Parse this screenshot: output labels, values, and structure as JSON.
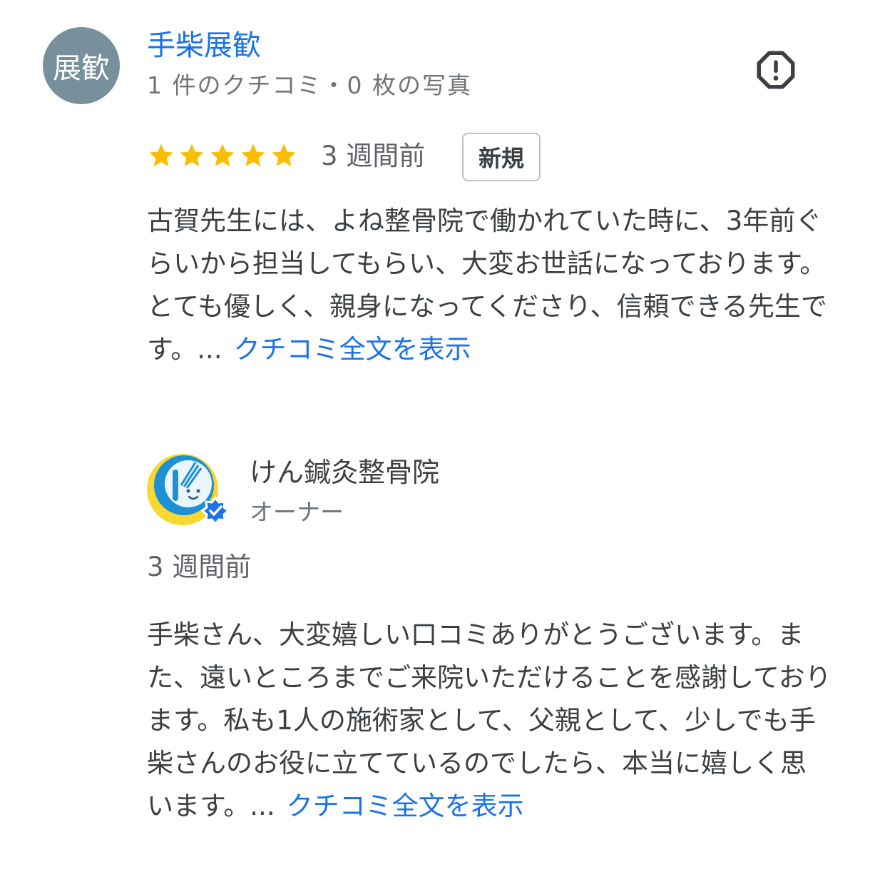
{
  "reviewer": {
    "avatar_text": "展歓",
    "name": "手柴展歓",
    "meta": "1 件のクチコミ・0 枚の写真"
  },
  "review": {
    "rating": 5,
    "rating_max": 5,
    "date": "3 週間前",
    "badge": "新規",
    "text_line1": "古賀先生には、よね整骨院で働かれていた時に、3年前ぐらいから担当してもらい、大変お世話になっております。",
    "text_line2": "とても優しく、親身になってくださり、信頼できる先生です。...",
    "more_label": "クチコミ全文を表示"
  },
  "owner_reply": {
    "name": "けん鍼灸整骨院",
    "role": "オーナー",
    "date": "3 週間前",
    "text": "手柴さん、大変嬉しい口コミありがとうございます。また、遠いところまでご来院いただけることを感謝しております。私も1人の施術家として、父親として、少しでも手柴さんのお役に立てているのでしたら、本当に嬉しく思います。...",
    "more_label": "クチコミ全文を表示"
  },
  "colors": {
    "link": "#1a73e8",
    "star": "#fbbc04",
    "avatar_bg": "#78909c",
    "verified": "#1a73e8"
  },
  "icons": {
    "report": "report-octagon-icon",
    "star": "star-icon",
    "verified": "verified-badge-icon"
  }
}
